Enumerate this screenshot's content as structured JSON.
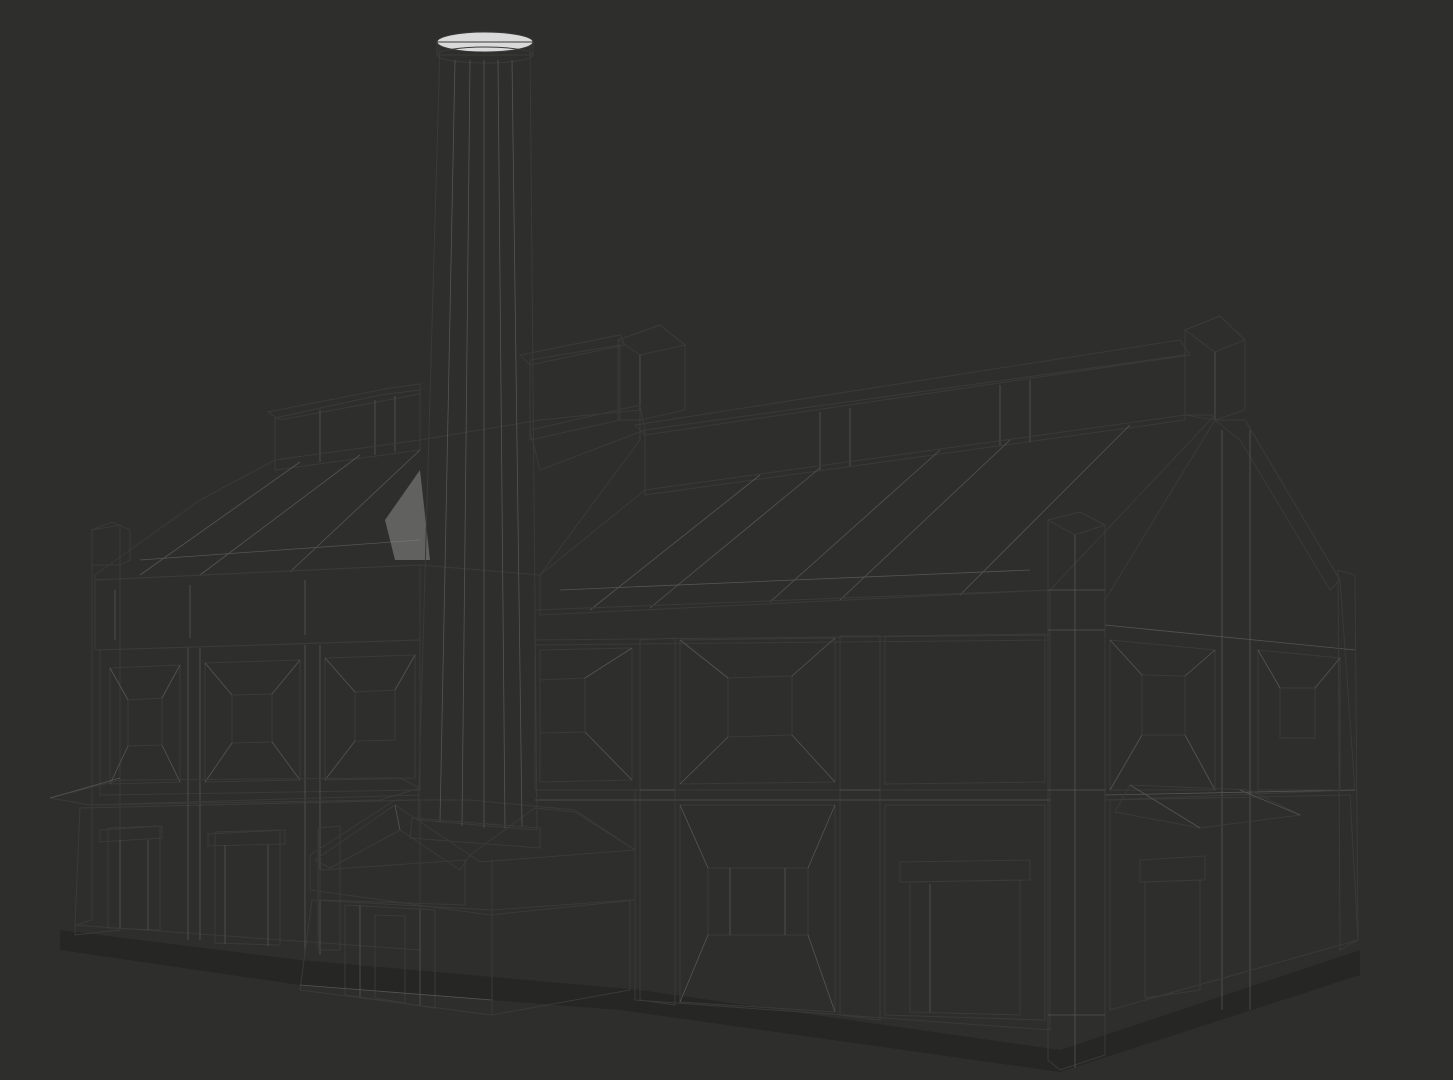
{
  "scene": {
    "background_color": "#2e2e2c",
    "model_color": "#d6d6d6",
    "wire_color": "#3a3a3a",
    "shadow_color": "#a8a8a8"
  }
}
